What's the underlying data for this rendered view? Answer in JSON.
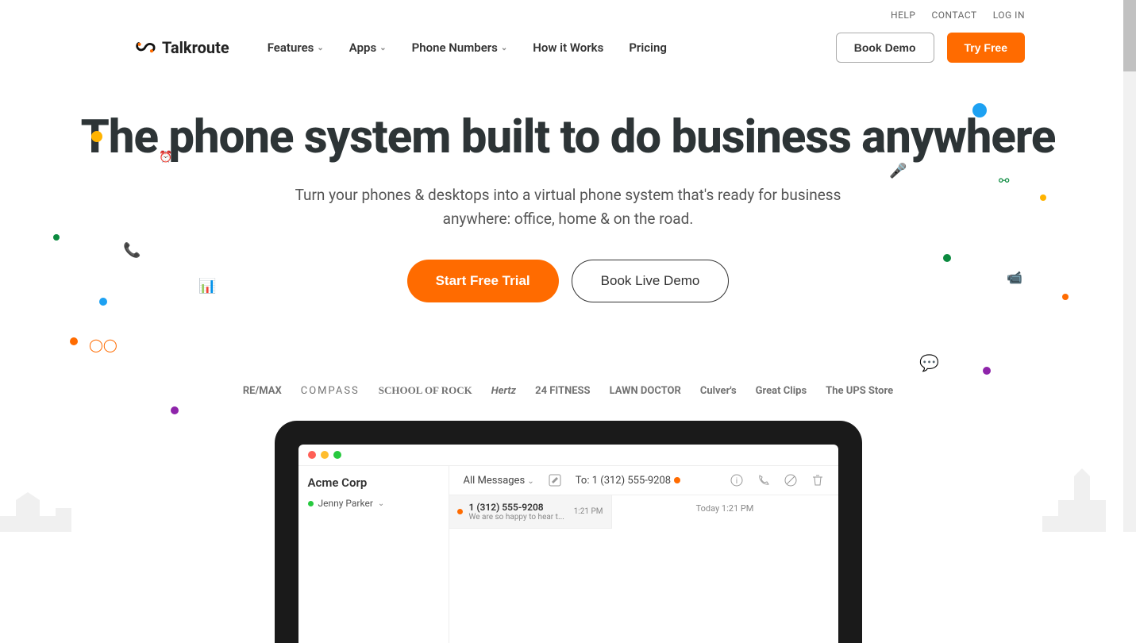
{
  "topLinks": {
    "help": "HELP",
    "contact": "CONTACT",
    "login": "LOG IN"
  },
  "brand": "Talkroute",
  "nav": {
    "features": "Features",
    "apps": "Apps",
    "phoneNumbers": "Phone Numbers",
    "howItWorks": "How it Works",
    "pricing": "Pricing"
  },
  "headerActions": {
    "bookDemo": "Book Demo",
    "tryFree": "Try Free"
  },
  "hero": {
    "headline": "The phone system built to do business anywhere",
    "sub": "Turn your phones & desktops into a virtual phone system that's ready for business anywhere: office, home & on the road.",
    "cta1": "Start Free Trial",
    "cta2": "Book Live Demo"
  },
  "clientLogos": [
    "RE/MAX",
    "COMPASS",
    "SCHOOL OF ROCK",
    "Hertz",
    "24 FITNESS",
    "LAWN DOCTOR",
    "Culver's",
    "Great Clips",
    "The UPS Store"
  ],
  "app": {
    "sidebarTitle": "Acme Corp",
    "sidebarUser": "Jenny Parker",
    "toolbarFilter": "All Messages",
    "toLabel": "To: 1 (312) 555-9208",
    "msgNumber": "1 (312) 555-9208",
    "msgPreview": "We are so happy to hear t...",
    "msgTime": "1:21 PM",
    "threadTime": "Today 1:21 PM"
  }
}
